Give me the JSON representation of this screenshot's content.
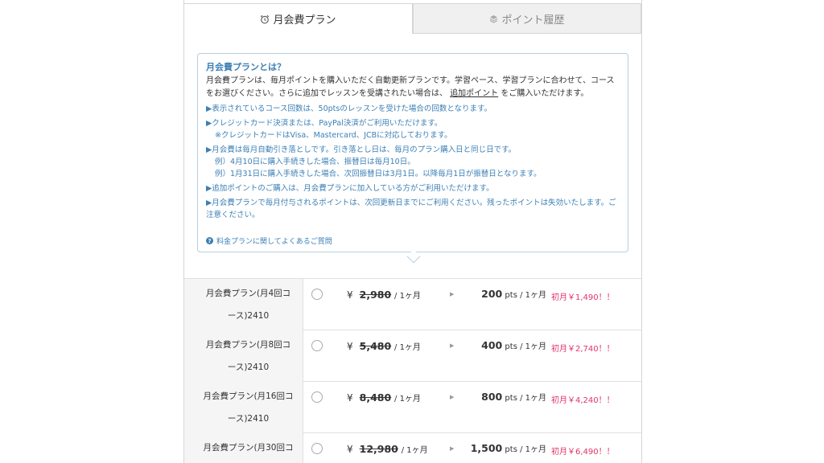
{
  "tabs": [
    {
      "label": "月会費プラン",
      "icon": "alarm-clock-icon",
      "active": true
    },
    {
      "label": "ポイント履歴",
      "icon": "coins-stack-icon",
      "active": false
    }
  ],
  "info": {
    "title": "月会費プランとは？",
    "intro_part1": "月会費プランは、毎月ポイントを購入いただく自動更新プランです。学習ペース、学習プランに合わせて、コースをお選びください。さらに追加でレッスンを受講されたい場合は、",
    "intro_link": "追加ポイント",
    "intro_part2": "をご購入いただけます。",
    "notes": [
      {
        "main": "▶表示されているコース回数は、50ptsのレッスンを受けた場合の回数となります。",
        "subs": []
      },
      {
        "main": "▶クレジットカード決済または、PayPal決済がご利用いただけます。",
        "subs": [
          "※クレジットカードはVisa、Mastercard、JCBに対応しております。"
        ]
      },
      {
        "main": "▶月会費は毎月自動引き落としです。引き落とし日は、毎月のプラン購入日と同じ日です。",
        "subs": [
          "例）4月10日に購入手続きした場合、振替日は毎月10日。",
          "例）1月31日に購入手続きした場合、次回振替日は3月1日。以降毎月1日が振替日となります。"
        ]
      },
      {
        "main": "▶追加ポイントのご購入は、月会費プランに加入している方がご利用いただけます。",
        "subs": []
      },
      {
        "main": "▶月会費プランで毎月付与されるポイントは、次回更新日までにご利用ください。残ったポイントは失効いたします。ご注意ください。",
        "subs": []
      }
    ],
    "faq_link": "料金プランに関してよくあるご質問"
  },
  "plans": [
    {
      "name": "月会費プラン(月4回コース)2410",
      "yen": "¥",
      "old_price": "2,980",
      "per": "/ 1ヶ月",
      "points": "200",
      "pts_unit": "pts / 1ヶ月",
      "promo": "初月￥1,490！！"
    },
    {
      "name": "月会費プラン(月8回コース)2410",
      "yen": "¥",
      "old_price": "5,480",
      "per": "/ 1ヶ月",
      "points": "400",
      "pts_unit": "pts / 1ヶ月",
      "promo": "初月￥2,740！！"
    },
    {
      "name": "月会費プラン(月16回コース)2410",
      "yen": "¥",
      "old_price": "8,480",
      "per": "/ 1ヶ月",
      "points": "800",
      "pts_unit": "pts / 1ヶ月",
      "promo": "初月￥4,240！！"
    },
    {
      "name": "月会費プラン(月30回コー",
      "yen": "¥",
      "old_price": "12,980",
      "per": "/ 1ヶ月",
      "points": "1,500",
      "pts_unit": "pts / 1ヶ月",
      "promo": "初月￥6,490！！"
    }
  ],
  "colors": {
    "accent_blue": "#3a7fb5",
    "promo_pink": "#e2336b"
  }
}
